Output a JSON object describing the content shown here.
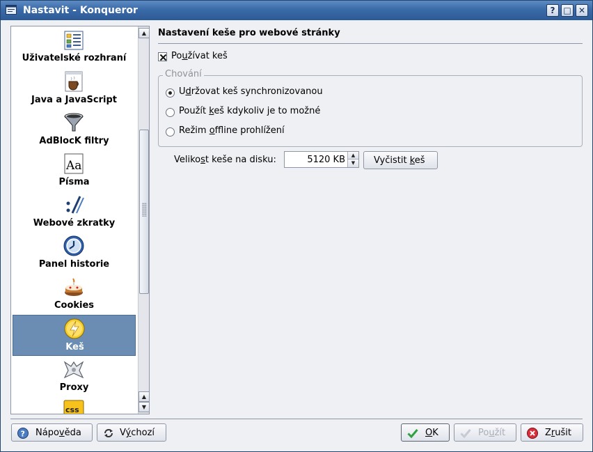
{
  "window": {
    "title": "Nastavit - Konqueror",
    "buttons": {
      "help": "?",
      "maximize": "□",
      "close": "✕"
    }
  },
  "sidebar": {
    "items": [
      {
        "label": "Uživatelské rozhraní",
        "icon": "ui-layout-icon"
      },
      {
        "label": "Java a JavaScript",
        "icon": "java-coffee-icon"
      },
      {
        "label": "AdBlocK filtry",
        "icon": "funnel-icon"
      },
      {
        "label": "Písma",
        "icon": "font-icon"
      },
      {
        "label": "Webové zkratky",
        "icon": "web-shortcuts-icon"
      },
      {
        "label": "Panel historie",
        "icon": "history-clock-icon"
      },
      {
        "label": "Cookies",
        "icon": "cake-icon"
      },
      {
        "label": "Keš",
        "icon": "lightning-icon",
        "selected": true
      },
      {
        "label": "Proxy",
        "icon": "proxy-icon"
      },
      {
        "label": "",
        "icon": "css-icon"
      }
    ]
  },
  "panel": {
    "title": "Nastavení keše pro webové stránky",
    "use_cache": {
      "label_pre": "Po",
      "label_key": "u",
      "label_post": "žívat keš",
      "checked": true
    },
    "behavior_group": {
      "title": "Chování",
      "options": [
        {
          "pre": "U",
          "key": "d",
          "post": "ržovat keš synchronizovanou",
          "checked": true
        },
        {
          "pre": "Použít ",
          "key": "k",
          "post": "eš kdykoliv je to možné",
          "checked": false
        },
        {
          "pre": "Režim ",
          "key": "o",
          "post": "ffline prohlížení",
          "checked": false
        }
      ]
    },
    "disk_size": {
      "label_pre": "Veliko",
      "label_key": "s",
      "label_post": "t keše na disku:",
      "value": "5120 KB"
    },
    "clear_button": {
      "pre": "Vyčistit ",
      "key": "k",
      "post": "eš"
    }
  },
  "footer": {
    "help": {
      "pre": "Nápo",
      "key": "v",
      "post": "ěda"
    },
    "defaults": {
      "pre": "V",
      "key": "ý",
      "post": "chozí"
    },
    "ok": {
      "pre": "",
      "key": "O",
      "post": "K"
    },
    "apply": {
      "pre": "Po",
      "key": "u",
      "post": "žít",
      "disabled": true
    },
    "cancel": {
      "pre": "Z",
      "key": "r",
      "post": "ušit"
    }
  },
  "colors": {
    "titlebar": "#3a6aa8",
    "selection": "#6b8db3",
    "window_bg": "#eff0f3"
  }
}
